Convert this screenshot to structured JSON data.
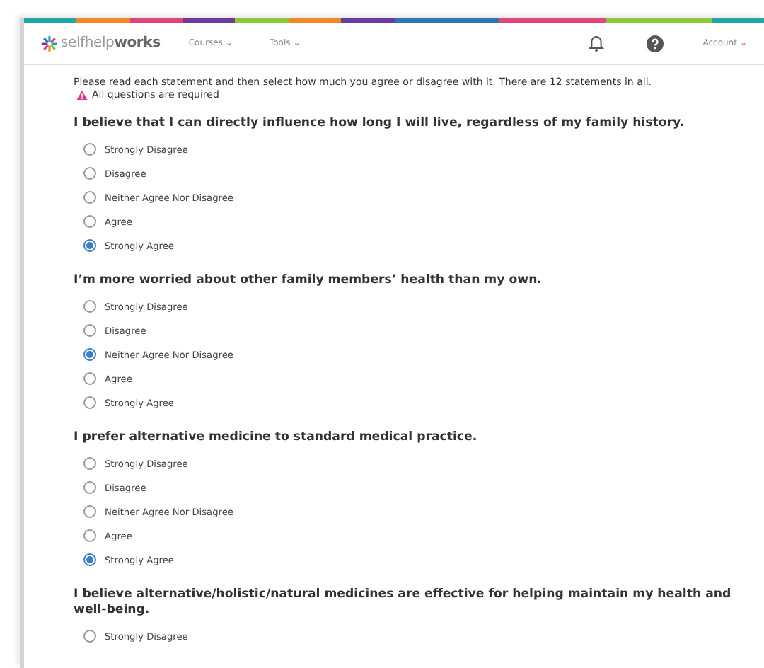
{
  "nav": {
    "logo": "selfhelp**works**",
    "menus": [
      {
        "label": "Courses",
        "caret": "⌄"
      },
      {
        "label": "Tools",
        "caret": "⌄"
      }
    ],
    "account": {
      "label": "Account",
      "caret": "⌄"
    }
  },
  "intro": "Please read each statement and then select how much you agree or disagree with it. There are 12 statements in all.",
  "required": "All questions are required",
  "questions": [
    {
      "statement": "I believe that I can directly influence how long I will live, regardless of my family history.",
      "options": [
        {
          "label": "Strongly Disagree",
          "selected": false
        },
        {
          "label": "Disagree",
          "selected": false
        },
        {
          "label": "Neither Agree Nor Disagree",
          "selected": false
        },
        {
          "label": "Agree",
          "selected": false
        },
        {
          "label": "Strongly Agree",
          "selected": true
        }
      ]
    },
    {
      "statement": "I’m more worried about other family members’ health than my own.",
      "options": [
        {
          "label": "Strongly Disagree",
          "selected": false
        },
        {
          "label": "Disagree",
          "selected": false
        },
        {
          "label": "Neither Agree Nor Disagree",
          "selected": true
        },
        {
          "label": "Agree",
          "selected": false
        },
        {
          "label": "Strongly Agree",
          "selected": false
        }
      ]
    },
    {
      "statement": "I prefer alternative medicine to standard medical practice.",
      "options": [
        {
          "label": "Strongly Disagree",
          "selected": false
        },
        {
          "label": "Disagree",
          "selected": false
        },
        {
          "label": "Neither Agree Nor Disagree",
          "selected": false
        },
        {
          "label": "Agree",
          "selected": false
        },
        {
          "label": "Strongly Agree",
          "selected": true
        }
      ]
    },
    {
      "statement": "I believe alternative/holistic/natural medicines are effective for helping maintain my health and well-being.",
      "options": [
        {
          "label": "Strongly Disagree",
          "selected": false
        }
      ]
    }
  ]
}
